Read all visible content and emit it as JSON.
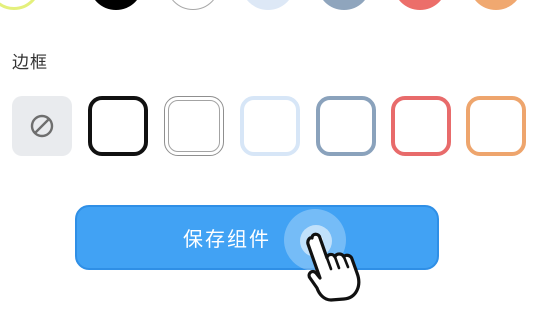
{
  "color_row": {
    "colors": [
      "#f3f38a",
      "#000000",
      "#ffffff",
      "#dde8f6",
      "#8fa5bd",
      "#ec6e6a",
      "#f0a870"
    ]
  },
  "border_section": {
    "label": "边框",
    "none_icon": "no-border-icon",
    "swatches": [
      {
        "name": "black",
        "color": "#111111",
        "style": "solid-thick"
      },
      {
        "name": "white",
        "color": "#9a9a9a",
        "style": "double-outline"
      },
      {
        "name": "light-blue",
        "color": "#d7e6f7",
        "style": "solid"
      },
      {
        "name": "slate",
        "color": "#8aa2bc",
        "style": "solid"
      },
      {
        "name": "red",
        "color": "#e86b6b",
        "style": "solid"
      },
      {
        "name": "orange",
        "color": "#eea56d",
        "style": "solid"
      }
    ]
  },
  "actions": {
    "save_label": "保存组件"
  },
  "pointer": {
    "icon": "hand-pointer-icon"
  }
}
